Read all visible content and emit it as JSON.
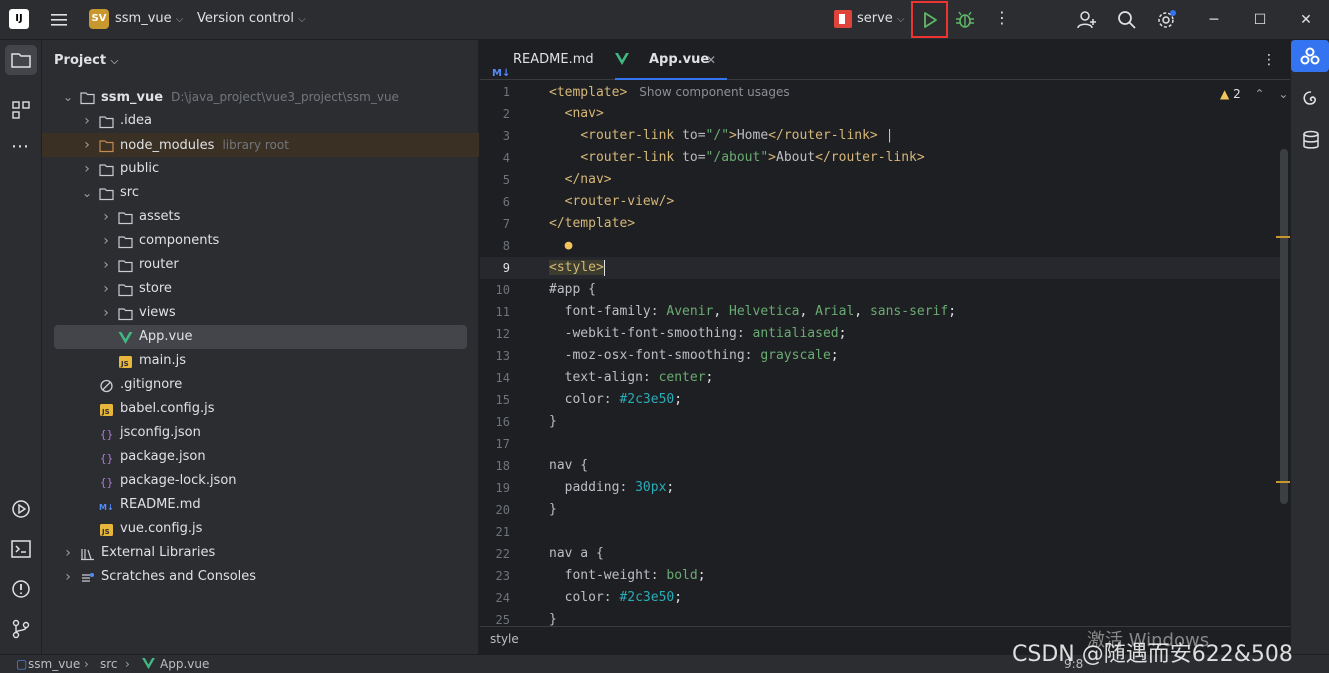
{
  "titlebar": {
    "logo": "IJ",
    "project_badge": "SV",
    "project_name": "ssm_vue",
    "vcs": "Version control",
    "run_config": "serve"
  },
  "project_panel": {
    "title": "Project",
    "tree": [
      {
        "label": "ssm_vue",
        "extra": "D:\\java_project\\vue3_project\\ssm_vue",
        "icon": "folder-icon",
        "arrow": "open"
      },
      {
        "label": ".idea",
        "extra": "",
        "icon": "folder-icon",
        "arrow": "closed"
      },
      {
        "label": "node_modules",
        "extra": "library root",
        "icon": "folder-icon-orange",
        "arrow": "closed"
      },
      {
        "label": "public",
        "extra": "",
        "icon": "folder-icon",
        "arrow": "closed"
      },
      {
        "label": "src",
        "extra": "",
        "icon": "folder-icon",
        "arrow": "open"
      },
      {
        "label": "assets",
        "extra": "",
        "icon": "folder-icon",
        "arrow": "closed"
      },
      {
        "label": "components",
        "extra": "",
        "icon": "folder-icon",
        "arrow": "closed"
      },
      {
        "label": "router",
        "extra": "",
        "icon": "folder-icon",
        "arrow": "closed"
      },
      {
        "label": "store",
        "extra": "",
        "icon": "folder-icon",
        "arrow": "closed"
      },
      {
        "label": "views",
        "extra": "",
        "icon": "folder-icon",
        "arrow": "closed"
      },
      {
        "label": "App.vue",
        "extra": "",
        "icon": "vue-icon",
        "arrow": ""
      },
      {
        "label": "main.js",
        "extra": "",
        "icon": "js-icon",
        "arrow": ""
      },
      {
        "label": ".gitignore",
        "extra": "",
        "icon": "ignore-icon",
        "arrow": ""
      },
      {
        "label": "babel.config.js",
        "extra": "",
        "icon": "js-icon",
        "arrow": ""
      },
      {
        "label": "jsconfig.json",
        "extra": "",
        "icon": "json-icon",
        "arrow": ""
      },
      {
        "label": "package.json",
        "extra": "",
        "icon": "json-icon",
        "arrow": ""
      },
      {
        "label": "package-lock.json",
        "extra": "",
        "icon": "json-icon",
        "arrow": ""
      },
      {
        "label": "README.md",
        "extra": "",
        "icon": "markdown-icon",
        "arrow": ""
      },
      {
        "label": "vue.config.js",
        "extra": "",
        "icon": "js-icon",
        "arrow": ""
      },
      {
        "label": "External Libraries",
        "extra": "",
        "icon": "library-icon",
        "arrow": "closed"
      },
      {
        "label": "Scratches and Consoles",
        "extra": "",
        "icon": "scratches-icon",
        "arrow": "closed"
      }
    ]
  },
  "editor": {
    "tabs": [
      {
        "label": "README.md",
        "icon": "M↓",
        "active": false
      },
      {
        "label": "App.vue",
        "icon": "vue",
        "active": true
      }
    ],
    "warnings_count": "2",
    "template_hint": "Show component usages",
    "line_numbers": [
      "1",
      "2",
      "3",
      "4",
      "5",
      "6",
      "7",
      "8",
      "9",
      "10",
      "11",
      "12",
      "13",
      "14",
      "15",
      "16",
      "17",
      "18",
      "19",
      "20",
      "21",
      "22",
      "23",
      "24",
      "25"
    ],
    "breadcrumb": "style"
  },
  "statusbar": {
    "crumbs": [
      "ssm_vue",
      "src",
      "App.vue"
    ],
    "position": "9:8",
    "watermark": "CSDN @随遇而安622&508",
    "windows_activate": "激活 Windows"
  }
}
